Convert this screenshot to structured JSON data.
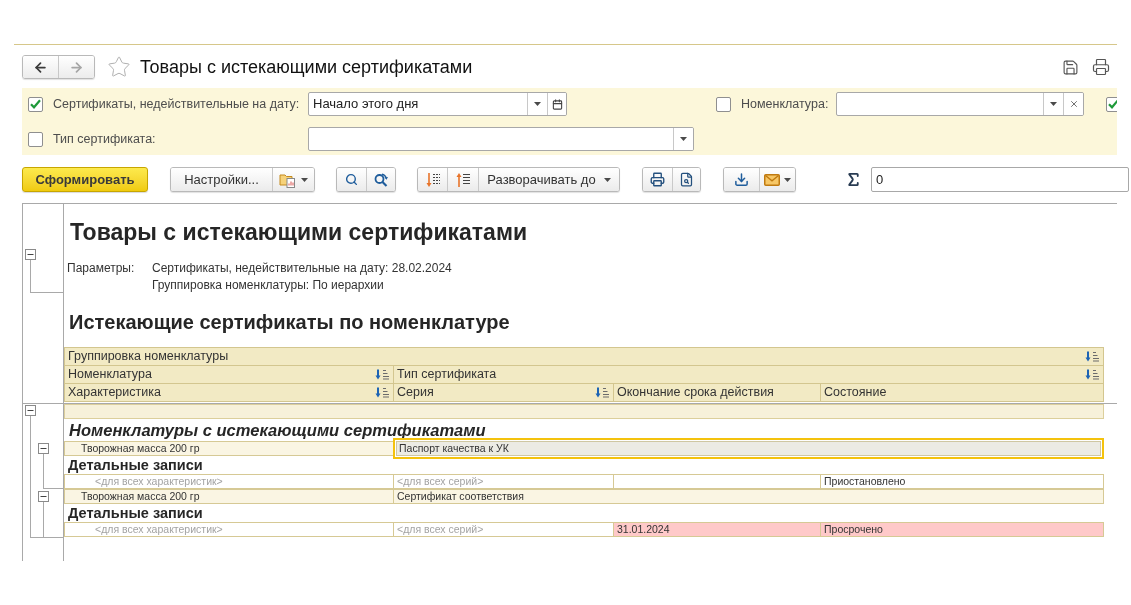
{
  "window": {
    "title": "Товары с истекающими сертификатами"
  },
  "navigation": [
    {
      "kind": "back",
      "disabled": false
    },
    {
      "kind": "forward",
      "disabled": true
    }
  ],
  "filter_rows": [
    [
      {
        "kind": "date",
        "checked": true,
        "label": "Сертификаты, недействительные на дату:",
        "value": "Начало этого дня"
      },
      {
        "kind": "reference",
        "checked": false,
        "label": "Номенклатура:"
      },
      {
        "kind": "flag",
        "checked": true
      }
    ],
    [
      {
        "kind": "choice",
        "checked": false,
        "label": "Тип сертификата:"
      }
    ]
  ],
  "toolbar": {
    "generate": "Сформировать",
    "settings": "Настройки...",
    "expand": "Разворачивать до",
    "sum": "0"
  },
  "report": {
    "expanded": true,
    "title": "Товары с истекающими сертификатами",
    "parameters_label": "Параметры:",
    "parameters": [
      "Сертификаты, недействительные на дату: 28.02.2024",
      "Группировка номенклатуры: По иерархии"
    ],
    "section_title": "Истекающие сертификаты по номенклатуре",
    "header_rows": [
      [
        {
          "label": "Группировка номенклатуры",
          "sortable": true
        }
      ],
      [
        {
          "label": "Номенклатура",
          "sortable": true
        },
        {
          "label": "Тип сертификата",
          "sortable": true
        }
      ],
      [
        {
          "label": "Характеристика",
          "sortable": true
        },
        {
          "label": "Серия",
          "sortable": true
        },
        {
          "label": "Окончание срока действия",
          "sortable": false
        },
        {
          "label": "Состояние",
          "sortable": false
        }
      ]
    ],
    "body": {
      "expanded": true,
      "group_title": "Номенклатуры с истекающими сертификатами",
      "items": [
        {
          "expanded": true,
          "selected": true,
          "name": "Творожная масса 200 гр",
          "certificate_type": "Паспорт качества к УК",
          "details_title": "Детальные записи",
          "details": [
            {
              "characteristic": "<для всех характеристик>",
              "series": "<для всех серий>",
              "status": "Приостановлено",
              "expired": false
            }
          ]
        },
        {
          "expanded": true,
          "selected": false,
          "name": "Творожная масса 200 гр",
          "certificate_type": "Сертификат соответствия",
          "details_title": "Детальные записи",
          "details": [
            {
              "characteristic": "<для всех характеристик>",
              "series": "<для всех серий>",
              "end_date": "31.01.2024",
              "status": "Просрочено",
              "expired": true
            }
          ]
        }
      ]
    }
  }
}
